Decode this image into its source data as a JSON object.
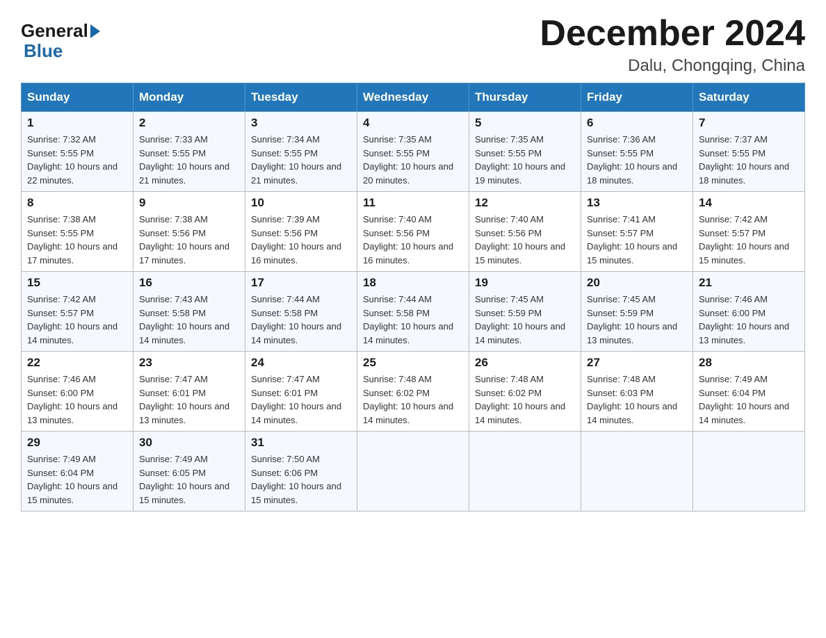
{
  "header": {
    "logo_general": "General",
    "logo_blue": "Blue",
    "month_title": "December 2024",
    "location": "Dalu, Chongqing, China"
  },
  "days_of_week": [
    "Sunday",
    "Monday",
    "Tuesday",
    "Wednesday",
    "Thursday",
    "Friday",
    "Saturday"
  ],
  "weeks": [
    [
      {
        "day": "1",
        "sunrise": "7:32 AM",
        "sunset": "5:55 PM",
        "daylight": "10 hours and 22 minutes."
      },
      {
        "day": "2",
        "sunrise": "7:33 AM",
        "sunset": "5:55 PM",
        "daylight": "10 hours and 21 minutes."
      },
      {
        "day": "3",
        "sunrise": "7:34 AM",
        "sunset": "5:55 PM",
        "daylight": "10 hours and 21 minutes."
      },
      {
        "day": "4",
        "sunrise": "7:35 AM",
        "sunset": "5:55 PM",
        "daylight": "10 hours and 20 minutes."
      },
      {
        "day": "5",
        "sunrise": "7:35 AM",
        "sunset": "5:55 PM",
        "daylight": "10 hours and 19 minutes."
      },
      {
        "day": "6",
        "sunrise": "7:36 AM",
        "sunset": "5:55 PM",
        "daylight": "10 hours and 18 minutes."
      },
      {
        "day": "7",
        "sunrise": "7:37 AM",
        "sunset": "5:55 PM",
        "daylight": "10 hours and 18 minutes."
      }
    ],
    [
      {
        "day": "8",
        "sunrise": "7:38 AM",
        "sunset": "5:55 PM",
        "daylight": "10 hours and 17 minutes."
      },
      {
        "day": "9",
        "sunrise": "7:38 AM",
        "sunset": "5:56 PM",
        "daylight": "10 hours and 17 minutes."
      },
      {
        "day": "10",
        "sunrise": "7:39 AM",
        "sunset": "5:56 PM",
        "daylight": "10 hours and 16 minutes."
      },
      {
        "day": "11",
        "sunrise": "7:40 AM",
        "sunset": "5:56 PM",
        "daylight": "10 hours and 16 minutes."
      },
      {
        "day": "12",
        "sunrise": "7:40 AM",
        "sunset": "5:56 PM",
        "daylight": "10 hours and 15 minutes."
      },
      {
        "day": "13",
        "sunrise": "7:41 AM",
        "sunset": "5:57 PM",
        "daylight": "10 hours and 15 minutes."
      },
      {
        "day": "14",
        "sunrise": "7:42 AM",
        "sunset": "5:57 PM",
        "daylight": "10 hours and 15 minutes."
      }
    ],
    [
      {
        "day": "15",
        "sunrise": "7:42 AM",
        "sunset": "5:57 PM",
        "daylight": "10 hours and 14 minutes."
      },
      {
        "day": "16",
        "sunrise": "7:43 AM",
        "sunset": "5:58 PM",
        "daylight": "10 hours and 14 minutes."
      },
      {
        "day": "17",
        "sunrise": "7:44 AM",
        "sunset": "5:58 PM",
        "daylight": "10 hours and 14 minutes."
      },
      {
        "day": "18",
        "sunrise": "7:44 AM",
        "sunset": "5:58 PM",
        "daylight": "10 hours and 14 minutes."
      },
      {
        "day": "19",
        "sunrise": "7:45 AM",
        "sunset": "5:59 PM",
        "daylight": "10 hours and 14 minutes."
      },
      {
        "day": "20",
        "sunrise": "7:45 AM",
        "sunset": "5:59 PM",
        "daylight": "10 hours and 13 minutes."
      },
      {
        "day": "21",
        "sunrise": "7:46 AM",
        "sunset": "6:00 PM",
        "daylight": "10 hours and 13 minutes."
      }
    ],
    [
      {
        "day": "22",
        "sunrise": "7:46 AM",
        "sunset": "6:00 PM",
        "daylight": "10 hours and 13 minutes."
      },
      {
        "day": "23",
        "sunrise": "7:47 AM",
        "sunset": "6:01 PM",
        "daylight": "10 hours and 13 minutes."
      },
      {
        "day": "24",
        "sunrise": "7:47 AM",
        "sunset": "6:01 PM",
        "daylight": "10 hours and 14 minutes."
      },
      {
        "day": "25",
        "sunrise": "7:48 AM",
        "sunset": "6:02 PM",
        "daylight": "10 hours and 14 minutes."
      },
      {
        "day": "26",
        "sunrise": "7:48 AM",
        "sunset": "6:02 PM",
        "daylight": "10 hours and 14 minutes."
      },
      {
        "day": "27",
        "sunrise": "7:48 AM",
        "sunset": "6:03 PM",
        "daylight": "10 hours and 14 minutes."
      },
      {
        "day": "28",
        "sunrise": "7:49 AM",
        "sunset": "6:04 PM",
        "daylight": "10 hours and 14 minutes."
      }
    ],
    [
      {
        "day": "29",
        "sunrise": "7:49 AM",
        "sunset": "6:04 PM",
        "daylight": "10 hours and 15 minutes."
      },
      {
        "day": "30",
        "sunrise": "7:49 AM",
        "sunset": "6:05 PM",
        "daylight": "10 hours and 15 minutes."
      },
      {
        "day": "31",
        "sunrise": "7:50 AM",
        "sunset": "6:06 PM",
        "daylight": "10 hours and 15 minutes."
      },
      null,
      null,
      null,
      null
    ]
  ]
}
